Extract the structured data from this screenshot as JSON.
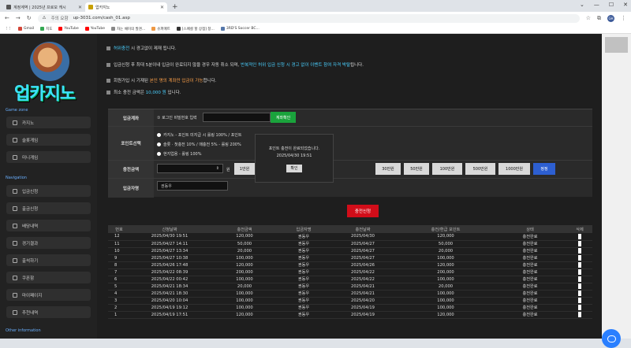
{
  "browser": {
    "tabs": [
      {
        "title": "계정계역 | 2025년 프로모 캐시"
      },
      {
        "title": "업카지노"
      }
    ],
    "new_tab": "+",
    "security": "주의 요함",
    "url": "up-3031.com/cash_01.asp",
    "bookmarks": [
      "Gmail",
      "지도",
      "YouTube",
      "YouTube",
      "자는 채이의 발견...",
      "슈퍼매트",
      "[스페셜 할 상점] 창...",
      "3RD'S Soccer BC..."
    ],
    "profile": "GH"
  },
  "logo": {
    "text": "업카지노"
  },
  "sidebar": {
    "sections": [
      {
        "title": "Game zone",
        "items": [
          "카지노",
          "슬롯게임",
          "미니게임"
        ]
      },
      {
        "title": "Navigation",
        "items": [
          "입금신청",
          "출금신청",
          "배당내역",
          "경기결과",
          "출석하기",
          "쿠폰함",
          "마이페이지",
          "추천내역"
        ]
      },
      {
        "title": "Other information",
        "items": []
      }
    ]
  },
  "notices": [
    {
      "pre": "",
      "hl": "허위충전",
      "rest": " 시 경고없이 제재 됩니다."
    },
    {
      "pre": "입금신청 후 최대 5분이내 입금이 완료되지 않을 경우 자동 취소 되며, ",
      "hl": "반복적인 허위 입금 신청 시 경고 없이 이벤트 참여 자격 박탈",
      "rest": "됩니다."
    },
    {
      "pre": "회원가입 시 기재된 ",
      "hl": "본인 명의 계좌만 입금이 가능",
      "rest": "합니다."
    },
    {
      "pre": "최소 충전 금액은 ",
      "hl": "10,000 원",
      "rest": " 입니다."
    }
  ],
  "form": {
    "account_label": "입금계좌",
    "account_hint": "① 로그인 비밀번호 입력",
    "account_btn": "계좌확인",
    "point_label": "포인트선택",
    "points": [
      "카지노 - 포인트 미지급 시 롤링 100% / 포인트",
      "슬롯 · 첫충전 10% / 매충전 5% - 롤링 200%",
      "현지업용 - 롤링 100%"
    ],
    "amount_label": "충전금액",
    "amount_unit": "원",
    "amount_btns": [
      "1만원",
      "30만원",
      "50만원",
      "100만원",
      "500만원",
      "1000만원",
      "정정"
    ],
    "name_label": "입금자명",
    "name_value": "권동우",
    "submit": "충전신청"
  },
  "popup": {
    "message": "포인트 충전이 완료되었습니다.",
    "time": "2025/04/30 19:51",
    "ok": "확인"
  },
  "table": {
    "headers": [
      "번호",
      "신청날짜",
      "충전금액",
      "입금자명",
      "충전날짜",
      "충전/환급 포인트",
      "상태",
      "삭제"
    ],
    "rows": [
      [
        "12",
        "2025/04/30 19:51",
        "120,000",
        "권동우",
        "2025/04/30",
        "120,000",
        "충전완료"
      ],
      [
        "11",
        "2025/04/27 14:11",
        "50,000",
        "권동우",
        "2025/04/27",
        "50,000",
        "충전완료"
      ],
      [
        "10",
        "2025/04/27 13:34",
        "20,000",
        "권동우",
        "2025/04/27",
        "20,000",
        "충전완료"
      ],
      [
        "9",
        "2025/04/27 10:38",
        "100,000",
        "권동우",
        "2025/04/27",
        "100,000",
        "충전완료"
      ],
      [
        "8",
        "2025/04/26 17:48",
        "120,000",
        "권동우",
        "2025/04/26",
        "120,000",
        "충전완료"
      ],
      [
        "7",
        "2025/04/22 08:39",
        "200,000",
        "권동우",
        "2025/04/22",
        "200,000",
        "충전완료"
      ],
      [
        "6",
        "2025/04/22 00:42",
        "100,000",
        "권동우",
        "2025/04/22",
        "100,000",
        "충전완료"
      ],
      [
        "5",
        "2025/04/21 18:34",
        "20,000",
        "권동우",
        "2025/04/21",
        "20,000",
        "충전완료"
      ],
      [
        "4",
        "2025/04/21 18:30",
        "100,000",
        "권동우",
        "2025/04/21",
        "100,000",
        "충전완료"
      ],
      [
        "3",
        "2025/04/20 10:04",
        "100,000",
        "권동우",
        "2025/04/20",
        "100,000",
        "충전완료"
      ],
      [
        "2",
        "2025/04/19 19:12",
        "100,000",
        "권동우",
        "2025/04/19",
        "100,000",
        "충전완료"
      ],
      [
        "1",
        "2025/04/19 17:51",
        "120,000",
        "권동우",
        "2025/04/19",
        "120,000",
        "충전완료"
      ]
    ]
  }
}
